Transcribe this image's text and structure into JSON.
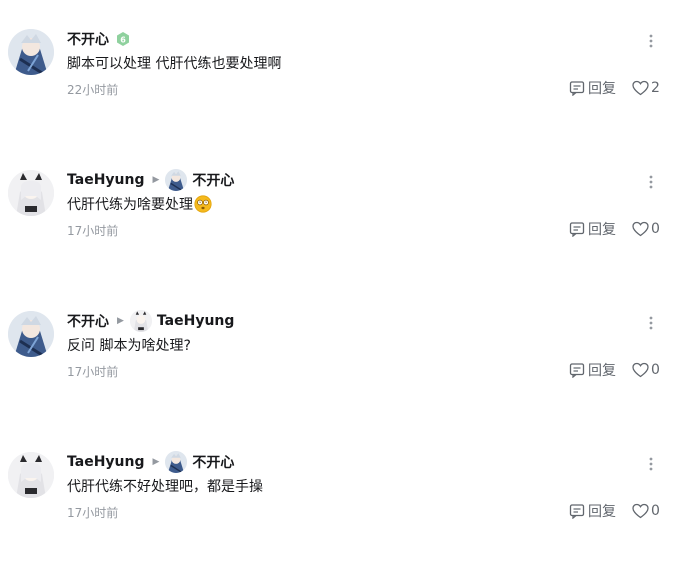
{
  "comments": [
    {
      "user": "不开心",
      "avatar_style": "user-a",
      "level_badge": true,
      "reply_to": null,
      "text": "脚本可以处理 代肝代练也要处理啊",
      "emoji": null,
      "time": "22小时前",
      "reply_label": "回复",
      "likes": "2"
    },
    {
      "user": "TaeHyung",
      "avatar_style": "user-b",
      "level_badge": false,
      "reply_to": "不开心",
      "reply_to_avatar_style": "user-a",
      "text": "代肝代练为啥要处理",
      "emoji": "dizzy-face-emoji",
      "time": "17小时前",
      "reply_label": "回复",
      "likes": "0"
    },
    {
      "user": "不开心",
      "avatar_style": "user-a",
      "level_badge": false,
      "reply_to": "TaeHyung",
      "reply_to_avatar_style": "user-b",
      "text": "反问 脚本为啥处理?",
      "emoji": null,
      "time": "17小时前",
      "reply_label": "回复",
      "likes": "0"
    },
    {
      "user": "TaeHyung",
      "avatar_style": "user-b",
      "level_badge": false,
      "reply_to": "不开心",
      "reply_to_avatar_style": "user-a",
      "text": "代肝代练不好处理吧，都是手操",
      "emoji": null,
      "time": "17小时前",
      "reply_label": "回复",
      "likes": "0"
    }
  ],
  "icons": {
    "more": "more-vertical-icon",
    "reply": "reply-comment-icon",
    "like": "heart-outline-icon",
    "reply_arrow": "triangle-right-icon",
    "level": "level-badge-icon"
  },
  "colors": {
    "text_primary": "#18191c",
    "text_secondary": "#61666d",
    "text_muted": "#9499a0",
    "level_badge": "#8fd19e"
  }
}
